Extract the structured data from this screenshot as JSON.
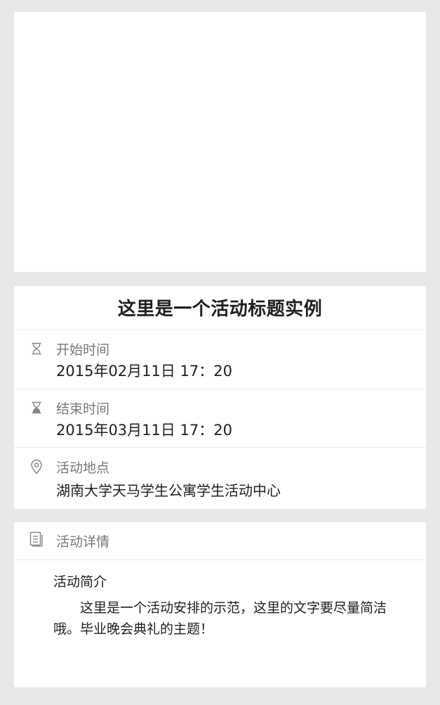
{
  "event": {
    "title": "这里是一个活动标题实例",
    "start": {
      "label": "开始时间",
      "value": "2015年02月11日  17：20",
      "icon": "hourglass-outline-icon"
    },
    "end": {
      "label": "结束时间",
      "value": "2015年03月11日  17：20",
      "icon": "hourglass-filled-icon"
    },
    "place": {
      "label": "活动地点",
      "value": "湖南大学天马学生公寓学生活动中心",
      "icon": "location-pin-icon"
    }
  },
  "details": {
    "header_label": "活动详情",
    "icon": "document-icon",
    "intro_title": "活动简介",
    "intro_text": "这里是一个活动安排的示范，这里的文字要尽量简洁哦。毕业晚会典礼的主题！"
  }
}
